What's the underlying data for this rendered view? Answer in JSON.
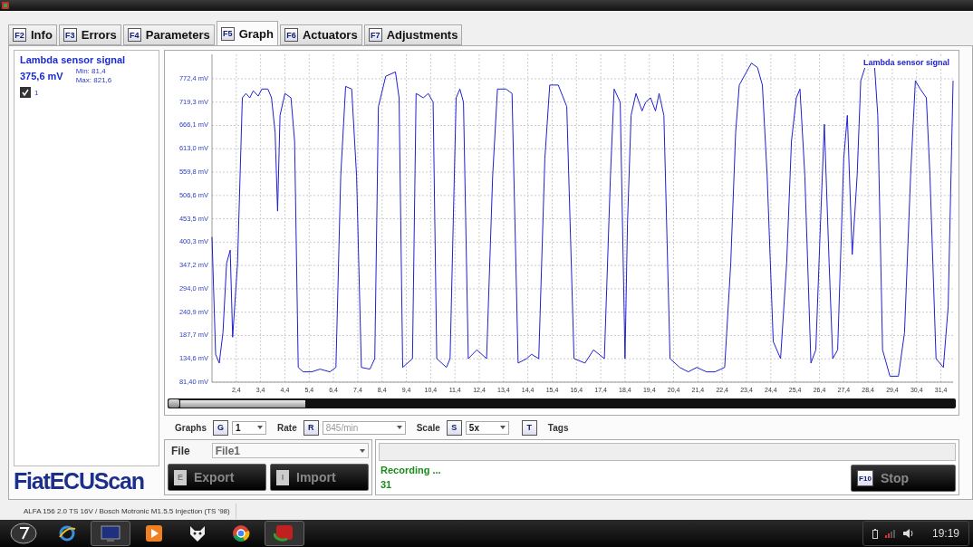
{
  "tabs": [
    {
      "key": "F2",
      "label": "Info",
      "selected": false
    },
    {
      "key": "F3",
      "label": "Errors",
      "selected": false
    },
    {
      "key": "F4",
      "label": "Parameters",
      "selected": false
    },
    {
      "key": "F5",
      "label": "Graph",
      "selected": true
    },
    {
      "key": "F6",
      "label": "Actuators",
      "selected": false
    },
    {
      "key": "F7",
      "label": "Adjustments",
      "selected": false
    }
  ],
  "signal_panel": {
    "title": "Lambda sensor signal",
    "value": "375,6 mV",
    "min": "Min: 81,4",
    "max": "Max: 821,6",
    "channels": [
      {
        "label": "1",
        "checked": true
      }
    ]
  },
  "logo": "FiatECUScan",
  "graph": {
    "chart_data": {
      "type": "line",
      "grid": true,
      "xlim": [
        1.4,
        31.9
      ],
      "ylim": [
        81.4,
        828
      ],
      "xticks": [
        {
          "value": 2.4,
          "label": "2,4"
        },
        {
          "value": 3.4,
          "label": "3,4"
        },
        {
          "value": 4.4,
          "label": "4,4"
        },
        {
          "value": 5.4,
          "label": "5,4"
        },
        {
          "value": 6.4,
          "label": "6,4"
        },
        {
          "value": 7.4,
          "label": "7,4"
        },
        {
          "value": 8.4,
          "label": "8,4"
        },
        {
          "value": 9.4,
          "label": "9,4"
        },
        {
          "value": 10.4,
          "label": "10,4"
        },
        {
          "value": 11.4,
          "label": "11,4"
        },
        {
          "value": 12.4,
          "label": "12,4"
        },
        {
          "value": 13.4,
          "label": "13,4"
        },
        {
          "value": 14.4,
          "label": "14,4"
        },
        {
          "value": 15.4,
          "label": "15,4"
        },
        {
          "value": 16.4,
          "label": "16,4"
        },
        {
          "value": 17.4,
          "label": "17,4"
        },
        {
          "value": 18.4,
          "label": "18,4"
        },
        {
          "value": 19.4,
          "label": "19,4"
        },
        {
          "value": 20.4,
          "label": "20,4"
        },
        {
          "value": 21.4,
          "label": "21,4"
        },
        {
          "value": 22.4,
          "label": "22,4"
        },
        {
          "value": 23.4,
          "label": "23,4"
        },
        {
          "value": 24.4,
          "label": "24,4"
        },
        {
          "value": 25.4,
          "label": "25,4"
        },
        {
          "value": 26.4,
          "label": "26,4"
        },
        {
          "value": 27.4,
          "label": "27,4"
        },
        {
          "value": 28.4,
          "label": "28,4"
        },
        {
          "value": 29.4,
          "label": "29,4"
        },
        {
          "value": 30.4,
          "label": "30,4"
        },
        {
          "value": 31.4,
          "label": "31,4"
        }
      ],
      "yticks": [
        {
          "value": 81.4,
          "label": "81,40 mV"
        },
        {
          "value": 134.6,
          "label": "134,6 mV"
        },
        {
          "value": 187.7,
          "label": "187,7 mV"
        },
        {
          "value": 240.9,
          "label": "240,9 mV"
        },
        {
          "value": 294.0,
          "label": "294,0 mV"
        },
        {
          "value": 347.2,
          "label": "347,2 mV"
        },
        {
          "value": 400.3,
          "label": "400,3 mV"
        },
        {
          "value": 453.5,
          "label": "453,5 mV"
        },
        {
          "value": 506.6,
          "label": "506,6 mV"
        },
        {
          "value": 559.8,
          "label": "559,8 mV"
        },
        {
          "value": 613.0,
          "label": "613,0 mV"
        },
        {
          "value": 666.1,
          "label": "666,1 mV"
        },
        {
          "value": 719.3,
          "label": "719,3 mV"
        },
        {
          "value": 772.4,
          "label": "772,4 mV"
        }
      ],
      "x": [
        1.4,
        1.55,
        1.7,
        1.85,
        2.0,
        2.15,
        2.25,
        2.45,
        2.65,
        2.8,
        2.95,
        3.1,
        3.3,
        3.45,
        3.7,
        3.85,
        4.0,
        4.1,
        4.2,
        4.4,
        4.65,
        4.8,
        4.95,
        5.15,
        5.5,
        5.85,
        6.25,
        6.5,
        6.7,
        6.9,
        7.15,
        7.35,
        7.55,
        7.9,
        8.1,
        8.25,
        8.55,
        8.95,
        9.1,
        9.25,
        9.65,
        9.8,
        10.1,
        10.3,
        10.5,
        10.65,
        11.05,
        11.2,
        11.45,
        11.6,
        11.75,
        11.95,
        12.3,
        12.7,
        12.95,
        13.15,
        13.5,
        13.75,
        14.0,
        14.35,
        14.55,
        14.85,
        15.1,
        15.3,
        15.65,
        16.0,
        16.3,
        16.75,
        17.1,
        17.55,
        17.8,
        17.95,
        18.2,
        18.4,
        18.5,
        18.65,
        18.85,
        19.1,
        19.25,
        19.45,
        19.65,
        19.8,
        20.0,
        20.25,
        20.65,
        21.0,
        21.35,
        21.75,
        22.1,
        22.5,
        22.75,
        22.95,
        23.1,
        23.4,
        23.6,
        23.85,
        24.05,
        24.25,
        24.5,
        24.8,
        25.05,
        25.25,
        25.45,
        25.6,
        25.8,
        26.05,
        26.25,
        26.45,
        26.6,
        26.8,
        26.95,
        27.15,
        27.4,
        27.55,
        27.75,
        27.95,
        28.1,
        28.4,
        28.65,
        28.8,
        29.0,
        29.3,
        29.65,
        29.9,
        30.15,
        30.35,
        30.55,
        30.8,
        30.95,
        31.2,
        31.5,
        31.7,
        31.9
      ],
      "series": [
        {
          "name": "Lambda sensor signal",
          "color": "#2020d0",
          "values": [
            412,
            145,
            125,
            194,
            352,
            382,
            184,
            352,
            729,
            739,
            729,
            745,
            733,
            749,
            749,
            729,
            650,
            471,
            689,
            739,
            729,
            630,
            115,
            105,
            105,
            111,
            105,
            115,
            551,
            755,
            749,
            551,
            115,
            111,
            135,
            709,
            778,
            788,
            729,
            115,
            135,
            739,
            729,
            739,
            719,
            135,
            115,
            135,
            729,
            749,
            719,
            135,
            155,
            135,
            551,
            749,
            749,
            739,
            125,
            135,
            145,
            135,
            590,
            758,
            758,
            709,
            135,
            125,
            155,
            135,
            551,
            749,
            719,
            135,
            442,
            689,
            739,
            699,
            719,
            729,
            699,
            739,
            689,
            135,
            115,
            105,
            115,
            105,
            105,
            115,
            352,
            650,
            758,
            788,
            808,
            798,
            758,
            551,
            174,
            135,
            352,
            630,
            729,
            749,
            551,
            125,
            155,
            452,
            669,
            352,
            135,
            155,
            590,
            689,
            372,
            551,
            768,
            819,
            818,
            689,
            155,
            95,
            95,
            194,
            551,
            768,
            749,
            729,
            551,
            135,
            115,
            254,
            768
          ]
        }
      ]
    }
  },
  "graph_controls": [
    {
      "kind": "select",
      "label": "Graphs",
      "key": "G",
      "value": "1",
      "disabled": false
    },
    {
      "kind": "select",
      "label": "Rate",
      "key": "R",
      "value": "845/min",
      "disabled": true
    },
    {
      "kind": "select",
      "label": "Scale",
      "key": "S",
      "value": "5x",
      "disabled": false
    },
    {
      "kind": "toggle",
      "label": "Tags",
      "key": "T"
    }
  ],
  "file": {
    "label": "File",
    "value": "File1",
    "buttons": [
      {
        "key": "E",
        "label": "Export"
      },
      {
        "key": "I",
        "label": "Import"
      }
    ]
  },
  "recording": {
    "progress": {
      "level": 0
    },
    "status": "Recording ...",
    "count": "31",
    "stop": {
      "key": "F10",
      "label": "Stop"
    }
  },
  "status_bar": "ALFA 156 2.0 TS 16V / Bosch Motronic M1.5.5 Injection (TS '98)",
  "taskbar": {
    "clock": "19:19"
  }
}
